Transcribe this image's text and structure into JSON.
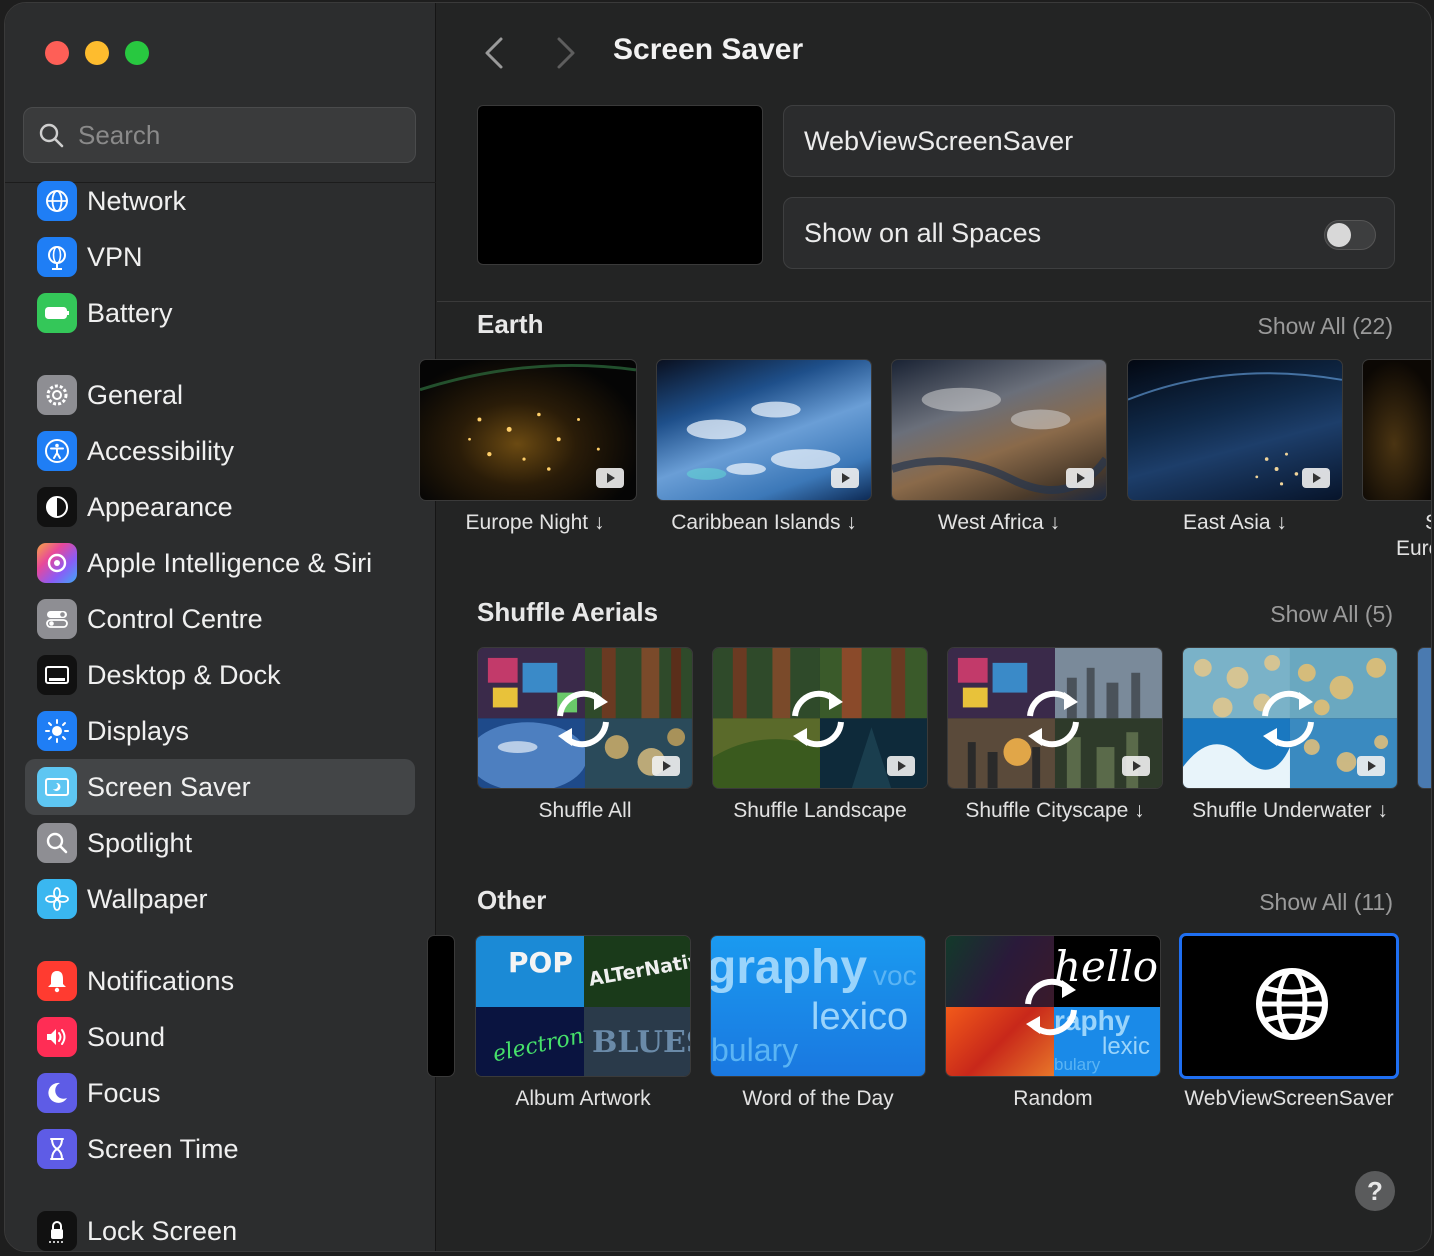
{
  "search": {
    "placeholder": "Search"
  },
  "sidebar": {
    "items": [
      {
        "label": "Network",
        "icon": "network-icon",
        "color": "#1f7ef5"
      },
      {
        "label": "VPN",
        "icon": "vpn-icon",
        "color": "#1f7ef5"
      },
      {
        "label": "Battery",
        "icon": "battery-icon",
        "color": "#34c759"
      },
      {
        "label": "General",
        "icon": "gear-icon",
        "color": "#8e8e93"
      },
      {
        "label": "Accessibility",
        "icon": "accessibility-icon",
        "color": "#1f7ef5"
      },
      {
        "label": "Appearance",
        "icon": "appearance-icon",
        "color": "#1c1c1e"
      },
      {
        "label": "Apple Intelligence & Siri",
        "icon": "siri-icon",
        "color": "#b45cf0"
      },
      {
        "label": "Control Centre",
        "icon": "control-centre-icon",
        "color": "#8e8e93"
      },
      {
        "label": "Desktop & Dock",
        "icon": "dock-icon",
        "color": "#1c1c1e"
      },
      {
        "label": "Displays",
        "icon": "displays-icon",
        "color": "#1f7ef5"
      },
      {
        "label": "Screen Saver",
        "icon": "screen-saver-icon",
        "color": "#4fc3f7"
      },
      {
        "label": "Spotlight",
        "icon": "spotlight-icon",
        "color": "#8e8e93"
      },
      {
        "label": "Wallpaper",
        "icon": "wallpaper-icon",
        "color": "#3ab7f0"
      },
      {
        "label": "Notifications",
        "icon": "bell-icon",
        "color": "#ff3b30"
      },
      {
        "label": "Sound",
        "icon": "sound-icon",
        "color": "#ff2d55"
      },
      {
        "label": "Focus",
        "icon": "moon-icon",
        "color": "#5e5ce6"
      },
      {
        "label": "Screen Time",
        "icon": "hourglass-icon",
        "color": "#5e5ce6"
      },
      {
        "label": "Lock Screen",
        "icon": "lock-icon",
        "color": "#1c1c1e"
      }
    ],
    "selected": "Screen Saver"
  },
  "header": {
    "title": "Screen Saver"
  },
  "current_saver": {
    "name": "WebViewScreenSaver"
  },
  "options": {
    "show_on_all_spaces_label": "Show on all Spaces",
    "show_on_all_spaces": false
  },
  "sections": {
    "earth": {
      "title": "Earth",
      "show_all": "Show All (22)",
      "items": [
        "Europe Night ↓",
        "Caribbean Islands ↓",
        "West Africa ↓",
        "East Asia ↓",
        "S",
        "Euro"
      ]
    },
    "shuffle": {
      "title": "Shuffle Aerials",
      "show_all": "Show All (5)",
      "items": [
        "Shuffle All",
        "Shuffle Landscape",
        "Shuffle Cityscape ↓",
        "Shuffle Underwater ↓"
      ]
    },
    "other": {
      "title": "Other",
      "show_all": "Show All (11)",
      "items": [
        "Album Artwork",
        "Word of the Day",
        "Random",
        "WebViewScreenSaver"
      ],
      "selected": "WebViewScreenSaver"
    }
  },
  "thumb_text": {
    "pop": "POP",
    "alternative": "ALTerNative",
    "electronic": "electronic",
    "blues": "BLUES",
    "word1": "graphy",
    "word2": "voc",
    "word3": "lexico",
    "word4": "bulary",
    "hello": "hello",
    "r1": "raphy",
    "r2": "lexic",
    "r3": "bulary"
  },
  "help": {
    "label": "?"
  },
  "colors": {
    "accent": "#1f6ff2"
  }
}
